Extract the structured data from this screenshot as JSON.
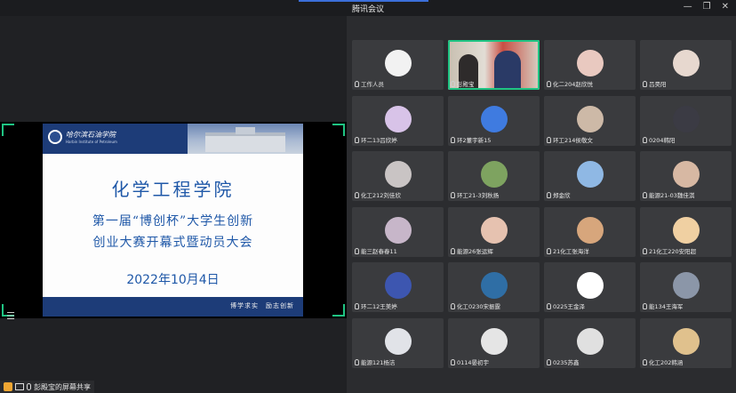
{
  "window": {
    "title": "腾讯会议",
    "minimize_glyph": "—",
    "restore_glyph": "❐",
    "close_glyph": "✕"
  },
  "slide": {
    "school_name": "哈尔滨石油学院",
    "school_name_en": "Harbin Institute of Petroleum",
    "title": "化学工程学院",
    "line1": "第一届“博创杯”大学生创新",
    "line2": "创业大赛开幕式暨动员大会",
    "date": "2022年10月4日",
    "motto": "博学求实　励志创新"
  },
  "share_bar": {
    "label": "彭殿宝的屏幕共享"
  },
  "list_button_glyph": "☰",
  "participants": [
    {
      "name": "工作人员",
      "avatar_color": "#f2f2f2",
      "icon": "emblem-avatar"
    },
    {
      "name": "彭殿宝",
      "video": true
    },
    {
      "name": "化二204赵欣悦",
      "avatar_color": "#e9c9c0",
      "icon": "anime-girl-avatar"
    },
    {
      "name": "吕昊阳",
      "avatar_color": "#e7d8cf",
      "icon": "cartoon-avatar"
    },
    {
      "name": "环二13吕欣婷",
      "avatar_color": "#d8c3e8",
      "icon": "cartoon-avatar"
    },
    {
      "name": "环2董宇新15",
      "avatar_color": "#3f7be0",
      "icon": "heart-avatar"
    },
    {
      "name": "环工214侯敬文",
      "avatar_color": "#cdb9a7",
      "icon": "photo-avatar"
    },
    {
      "name": "0204韩阳",
      "avatar_color": "#3b3b44",
      "icon": "anime-avatar"
    },
    {
      "name": "化工212刘佳欣",
      "avatar_color": "#c9c4c4",
      "icon": "photo-avatar"
    },
    {
      "name": "环工21-3刘秋扬",
      "avatar_color": "#7ea360",
      "icon": "landscape-avatar"
    },
    {
      "name": "郑金欣",
      "avatar_color": "#8fb8e4",
      "icon": "cartoon-avatar"
    },
    {
      "name": "能源21-03魏佳淇",
      "avatar_color": "#d7b8a3",
      "icon": "photo-avatar"
    },
    {
      "name": "能三赵春春11",
      "avatar_color": "#c7b6c9",
      "icon": "anime-avatar"
    },
    {
      "name": "能源26张运辉",
      "avatar_color": "#e6c2b0",
      "icon": "anime-avatar"
    },
    {
      "name": "21化工张海洋",
      "avatar_color": "#d7a67c",
      "icon": "photo-avatar"
    },
    {
      "name": "21化工220安阳超",
      "avatar_color": "#f0d0a2",
      "icon": "anime-avatar"
    },
    {
      "name": "环二12王美婷",
      "avatar_color": "#3d56b0",
      "icon": "cartoon-avatar"
    },
    {
      "name": "化工0230宋振霆",
      "avatar_color": "#2f6ea5",
      "icon": "emblem-avatar"
    },
    {
      "name": "0225王金泽",
      "avatar_color": "#ffffff",
      "icon": "waveform-avatar"
    },
    {
      "name": "能134王海军",
      "avatar_color": "#8b96a8",
      "icon": "landscape-avatar"
    },
    {
      "name": "能源121杨洁",
      "avatar_color": "#e1e3e8",
      "icon": "cartoon-avatar"
    },
    {
      "name": "0114晏初宇",
      "avatar_color": "#e5e5e5",
      "icon": "sketch-avatar"
    },
    {
      "name": "0235苏鑫",
      "avatar_color": "#e0e0e0",
      "icon": "sketch-avatar"
    },
    {
      "name": "化工202韩涵",
      "avatar_color": "#e0c18d",
      "icon": "photo-avatar"
    }
  ]
}
